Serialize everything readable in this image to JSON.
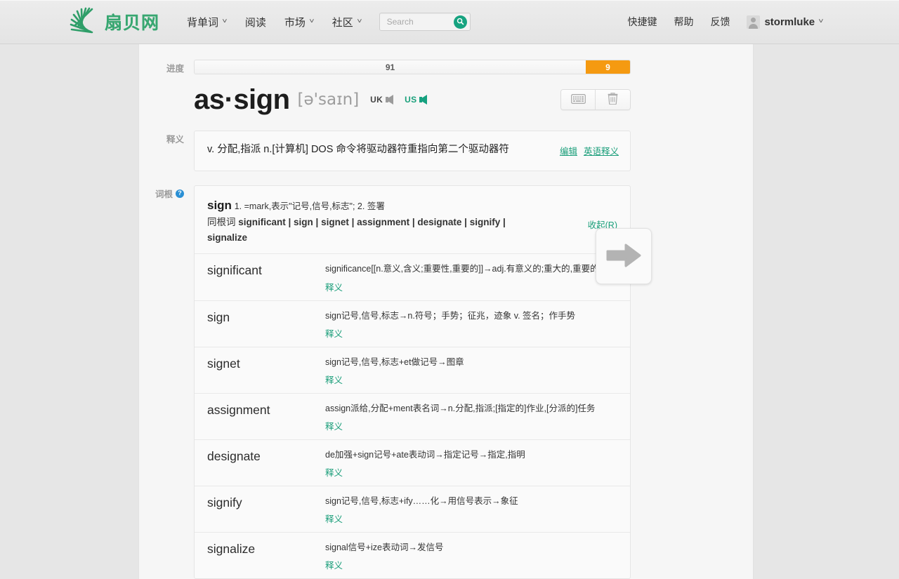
{
  "header": {
    "brand": "扇贝网",
    "brand_icon": "scallop-fan-logo",
    "nav": [
      {
        "label": "背单词",
        "caret": "˅"
      },
      {
        "label": "阅读",
        "caret": ""
      },
      {
        "label": "市场",
        "caret": "˅"
      },
      {
        "label": "社区",
        "caret": "˅"
      }
    ],
    "search": {
      "placeholder": "Search",
      "value": "",
      "icon": "search-icon"
    },
    "right_links": [
      {
        "label": "快捷键"
      },
      {
        "label": "帮助"
      },
      {
        "label": "反馈"
      }
    ],
    "user": {
      "name": "stormluke",
      "caret": "˅",
      "avatar_icon": "user-avatar-icon"
    }
  },
  "labels": {
    "progress": "进度",
    "definition": "释义",
    "root": "词根",
    "root_help": "?"
  },
  "progress": {
    "known_count": "91",
    "new_count": "9",
    "known_color": "#f2f2f2",
    "new_color": "#f59a11"
  },
  "word": {
    "headword": "as·sign",
    "phonetic": "[ə'saɪn]",
    "pron_uk_label": "UK",
    "pron_us_label": "US",
    "speaker_icon": "speaker-icon",
    "tools": [
      {
        "name": "keyboard-shortcut-button",
        "icon": "keyboard-icon"
      },
      {
        "name": "delete-word-button",
        "icon": "trash-icon"
      }
    ]
  },
  "definition": {
    "text": "v. 分配,指派 n.[计算机] DOS 命令将驱动器符重指向第二个驱动器符",
    "edit_label": "编辑",
    "english_label": "英语释义"
  },
  "root": {
    "name": "sign",
    "meaning": "1. =mark,表示\"记号,信号,标志\"; 2. 签署",
    "family_label": "同根词",
    "family": "significant | sign | signet | assignment | designate | signify | signalize",
    "collapse_label": "收起(R)",
    "items": [
      {
        "word": "significant",
        "explanation": "significance[[n.意义,含义;重要性,重要的]]→adj.有意义的;重大的,重要的",
        "link": "释义"
      },
      {
        "word": "sign",
        "explanation": "sign记号,信号,标志→n.符号；手势；征兆，迹象 v. 签名；作手势",
        "link": "释义"
      },
      {
        "word": "signet",
        "explanation": "sign记号,信号,标志+et做记号→图章",
        "link": "释义"
      },
      {
        "word": "assignment",
        "explanation": "assign派给,分配+ment表名词→n.分配,指派;[指定的]作业,[分派的]任务",
        "link": "释义"
      },
      {
        "word": "designate",
        "explanation": "de加强+sign记号+ate表动词→指定记号→指定,指明",
        "link": "释义"
      },
      {
        "word": "signify",
        "explanation": "sign记号,信号,标志+ify……化→用信号表示→象征",
        "link": "释义"
      },
      {
        "word": "signalize",
        "explanation": "signal信号+ize表动词→发信号",
        "link": "释义"
      }
    ]
  },
  "next_button": {
    "icon": "arrow-right-icon",
    "label": ""
  },
  "colors": {
    "brand_green": "#38a771",
    "link_green": "#1a9e7a",
    "orange": "#f59a11",
    "page_bg": "#e6e6e6",
    "card_bg": "#fafafa"
  }
}
